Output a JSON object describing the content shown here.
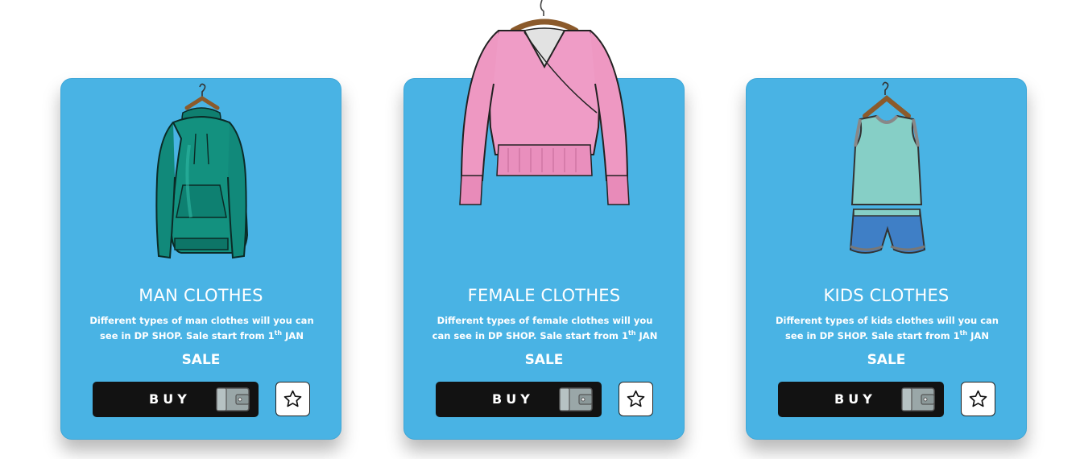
{
  "cards": [
    {
      "title": "MAN CLOTHES",
      "desc_main": "Different types of man clothes will you can see in DP SHOP. Sale start from 1",
      "desc_sup": "th",
      "desc_end": " JAN",
      "sale": "SALE",
      "buy_label": "BUY",
      "garment_icon": "green-hoodie",
      "wallet_icon": "wallet-icon",
      "star_icon": "star-outline-icon"
    },
    {
      "title": "FEMALE CLOTHES",
      "desc_main": "Different types of female clothes will you can see in DP SHOP. Sale start from 1",
      "desc_sup": "th",
      "desc_end": " JAN",
      "sale": "SALE",
      "buy_label": "BUY",
      "garment_icon": "pink-wrap-sweater",
      "wallet_icon": "wallet-icon",
      "star_icon": "star-outline-icon"
    },
    {
      "title": "KIDS CLOTHES",
      "desc_main": "Different types of kids clothes will you can see in DP SHOP. Sale start from 1",
      "desc_sup": "th",
      "desc_end": " JAN",
      "sale": "SALE",
      "buy_label": "BUY",
      "garment_icon": "kids-tank-and-shorts",
      "wallet_icon": "wallet-icon",
      "star_icon": "star-outline-icon"
    }
  ],
  "colors": {
    "card_bg": "#49b3e4",
    "button_bg": "#121212",
    "text": "#ffffff",
    "hoodie": "#13917f",
    "sweater": "#ef9cc6",
    "tank": "#86cfc6",
    "shorts": "#3f7fc6"
  }
}
